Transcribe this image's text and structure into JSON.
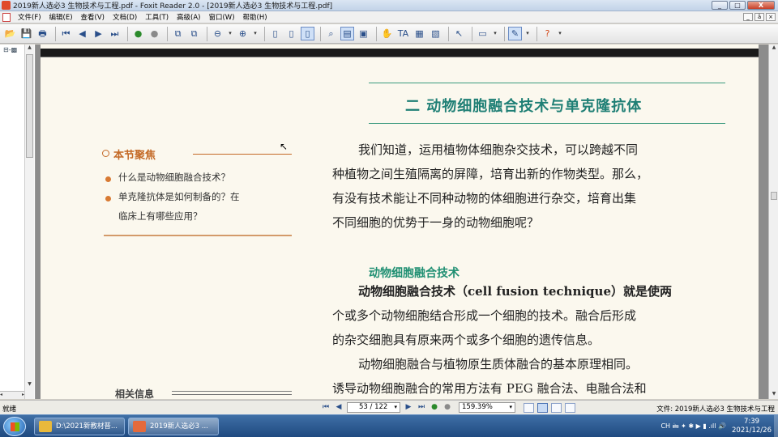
{
  "window": {
    "title": "2019新人选必3 生物技术与工程.pdf - Foxit Reader 2.0 - [2019新人选必3 生物技术与工程.pdf]",
    "min": "_",
    "max": "□",
    "close": "X"
  },
  "menu": {
    "items": [
      "文件(F)",
      "编辑(E)",
      "查看(V)",
      "文档(D)",
      "工具(T)",
      "高级(A)",
      "窗口(W)",
      "帮助(H)"
    ],
    "mdi": [
      "_",
      "ā",
      "×"
    ]
  },
  "toolbar": {
    "icons": [
      {
        "name": "open-icon",
        "glyph": "📂"
      },
      {
        "name": "save-icon",
        "glyph": "💾"
      },
      {
        "name": "print-icon",
        "glyph": "🖶"
      },
      {
        "name": "first-page-icon",
        "glyph": "⏮"
      },
      {
        "name": "prev-page-icon",
        "glyph": "◀"
      },
      {
        "name": "next-page-icon",
        "glyph": "▶"
      },
      {
        "name": "last-page-icon",
        "glyph": "⏭"
      },
      {
        "name": "go-back-icon",
        "glyph": "●"
      },
      {
        "name": "go-forward-icon",
        "glyph": "●"
      },
      {
        "name": "copy-icon",
        "glyph": "⧉"
      },
      {
        "name": "paste-icon",
        "glyph": "⧉"
      },
      {
        "name": "zoom-out-icon",
        "glyph": "⊖"
      },
      {
        "name": "zoom-in-icon",
        "glyph": "⊕"
      },
      {
        "name": "actual-size-icon",
        "glyph": "▯"
      },
      {
        "name": "fit-page-icon",
        "glyph": "▯"
      },
      {
        "name": "fit-width-icon",
        "glyph": "▯"
      },
      {
        "name": "binoculars-icon",
        "glyph": "⌕"
      },
      {
        "name": "single-page-icon",
        "glyph": "▤"
      },
      {
        "name": "form-icon",
        "glyph": "▣"
      },
      {
        "name": "hand-tool-icon",
        "glyph": "✋"
      },
      {
        "name": "text-select-icon",
        "glyph": "TA"
      },
      {
        "name": "snapshot-icon",
        "glyph": "▦"
      },
      {
        "name": "bookmark-icon",
        "glyph": "▧"
      },
      {
        "name": "select-arrow-icon",
        "glyph": "↖"
      },
      {
        "name": "comment-icon",
        "glyph": "▭"
      },
      {
        "name": "pencil-icon",
        "glyph": "✎"
      },
      {
        "name": "help-icon",
        "glyph": "?"
      }
    ]
  },
  "nav": {
    "tree": "⊟-▩"
  },
  "page": {
    "section_title": "二  动物细胞融合技术与单克隆抗体",
    "sidebox": {
      "title": "本节聚焦",
      "questions": [
        "什么是动物细胞融合技术？",
        "单克隆抗体是如何制备的？在",
        "临床上有哪些应用？"
      ]
    },
    "paragraphs": [
      "我们知道，运用植物体细胞杂交技术，可以跨越不同",
      "种植物之间生殖隔离的屏障，培育出新的作物类型。那么，",
      "有没有技术能让不同种动物的体细胞进行杂交，培育出集",
      "不同细胞的优势于一身的动物细胞呢？"
    ],
    "subhead": "动物细胞融合技术",
    "body": [
      "动物细胞融合技术（cell fusion technique）就是使两",
      "个或多个动物细胞结合形成一个细胞的技术。融合后形成",
      "的杂交细胞具有原来两个或多个细胞的遗传信息。",
      "动物细胞融合与植物原生质体融合的基本原理相同。",
      "诱导动物细胞融合的常用方法有 PEG 融合法、电融合法和"
    ],
    "related": "相关信息"
  },
  "status": {
    "ready": "就绪",
    "page_indicator": "53 / 122",
    "zoom": "159.39%",
    "file": "文件: 2019新人选必3 生物技术与工程"
  },
  "taskbar": {
    "tasks": [
      "D:\\2021新教材普...",
      "2019新人选必3 ..."
    ],
    "tray": "CH 🖮 ✦ ✱ ▶ ▮ .ıll 🔊",
    "time": "7:39",
    "date": "2021/12/26"
  }
}
